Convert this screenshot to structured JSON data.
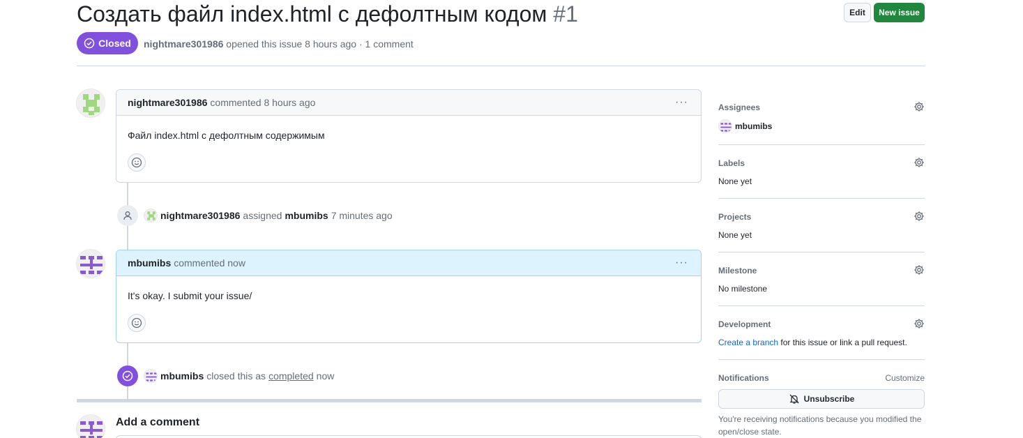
{
  "issue": {
    "title": "Создать файл index.html с дефолтным кодом",
    "number": "#1",
    "state": "Closed",
    "author": "nightmare301986",
    "opened_text": "opened this issue 8 hours ago · 1 comment"
  },
  "header_buttons": {
    "edit": "Edit",
    "new_issue": "New issue"
  },
  "comments": [
    {
      "author": "nightmare301986",
      "time": "commented 8 hours ago",
      "body": "Файл index.html с дефолтным содержимым",
      "menu": "···"
    },
    {
      "author": "mbumibs",
      "time": "commented now",
      "body": "It's okay. I submit your issue/",
      "menu": "···"
    }
  ],
  "events": {
    "assigned": {
      "actor": "nightmare301986",
      "verb": "assigned",
      "target": "mbumibs",
      "time": "7 minutes ago"
    },
    "closed": {
      "actor": "mbumibs",
      "verb": "closed this as",
      "reason": "completed",
      "time": "now"
    }
  },
  "add_comment": {
    "title": "Add a comment"
  },
  "sidebar": {
    "assignees": {
      "label": "Assignees",
      "value": "mbumibs"
    },
    "labels": {
      "label": "Labels",
      "value": "None yet"
    },
    "projects": {
      "label": "Projects",
      "value": "None yet"
    },
    "milestone": {
      "label": "Milestone",
      "value": "No milestone"
    },
    "development": {
      "label": "Development",
      "link": "Create a branch",
      "rest": "for this issue or link a pull request."
    },
    "notifications": {
      "label": "Notifications",
      "customize": "Customize",
      "button": "Unsubscribe",
      "note": "You're receiving notifications because you modified the open/close state."
    }
  },
  "colors": {
    "closed_purple": "#8250df",
    "primary_green": "#1f883d",
    "link_blue": "#0969da",
    "highlight_blue": "#ddf4ff"
  }
}
